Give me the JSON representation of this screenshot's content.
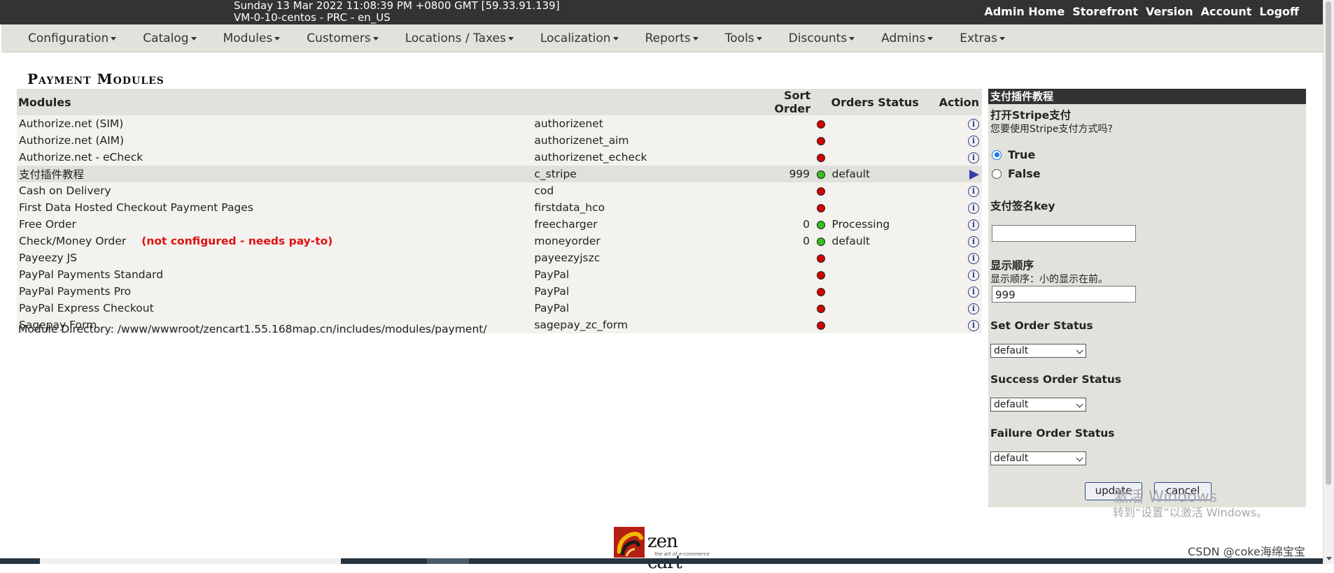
{
  "header": {
    "server_line1": "Sunday 13 Mar 2022 11:08:39 PM +0800 GMT [59.33.91.139]",
    "server_line2": "VM-0-10-centos - PRC - en_US",
    "links": [
      "Admin Home",
      "Storefront",
      "Version",
      "Account",
      "Logoff"
    ]
  },
  "nav": {
    "items": [
      "Configuration",
      "Catalog",
      "Modules",
      "Customers",
      "Locations / Taxes",
      "Localization",
      "Reports",
      "Tools",
      "Discounts",
      "Admins",
      "Extras"
    ]
  },
  "page_title": "Payment Modules",
  "table": {
    "headers": {
      "modules": "Modules",
      "sort_order": "Sort Order",
      "orders_status": "Orders Status",
      "action": "Action"
    },
    "rows": [
      {
        "name": "Authorize.net (SIM)",
        "code": "authorizenet",
        "sort": "",
        "status": "red",
        "order_status": "",
        "action": "info-icon"
      },
      {
        "name": "Authorize.net (AIM)",
        "code": "authorizenet_aim",
        "sort": "",
        "status": "red",
        "order_status": "",
        "action": "info-icon"
      },
      {
        "name": "Authorize.net - eCheck",
        "code": "authorizenet_echeck",
        "sort": "",
        "status": "red",
        "order_status": "",
        "action": "info-icon"
      },
      {
        "name": "支付插件教程",
        "code": "c_stripe",
        "sort": "999",
        "status": "green",
        "order_status": "default",
        "action": "play-icon"
      },
      {
        "name": "Cash on Delivery",
        "code": "cod",
        "sort": "",
        "status": "red",
        "order_status": "",
        "action": "info-icon"
      },
      {
        "name": "First Data Hosted Checkout Payment Pages",
        "code": "firstdata_hco",
        "sort": "",
        "status": "red",
        "order_status": "",
        "action": "info-icon"
      },
      {
        "name": "Free Order",
        "code": "freecharger",
        "sort": "0",
        "status": "green",
        "order_status": "Processing",
        "action": "info-icon"
      },
      {
        "name": "Check/Money Order",
        "warning": "(not configured - needs pay-to)",
        "code": "moneyorder",
        "sort": "0",
        "status": "green",
        "order_status": "default",
        "action": "info-icon"
      },
      {
        "name": "Payeezy JS",
        "code": "payeezyjszc",
        "sort": "",
        "status": "red",
        "order_status": "",
        "action": "info-icon"
      },
      {
        "name": "PayPal Payments Standard",
        "code": "PayPal",
        "sort": "",
        "status": "red",
        "order_status": "",
        "action": "info-icon"
      },
      {
        "name": "PayPal Payments Pro",
        "code": "PayPal",
        "sort": "",
        "status": "red",
        "order_status": "",
        "action": "info-icon"
      },
      {
        "name": "PayPal Express Checkout",
        "code": "PayPal",
        "sort": "",
        "status": "red",
        "order_status": "",
        "action": "info-icon"
      },
      {
        "name": "Sagepay Form",
        "code": "sagepay_zc_form",
        "sort": "",
        "status": "red",
        "order_status": "",
        "action": "info-icon"
      }
    ],
    "colors": {
      "status_red": "#d40000",
      "status_green": "#35c21d"
    }
  },
  "module_directory": "Module Directory: /www/wwwroot/zencart1.55.168map.cn/includes/modules/payment/",
  "panel": {
    "title": "支付插件教程",
    "enable_label": "打开Stripe支付",
    "enable_desc": "您要使用Stripe支付方式吗?",
    "option_true": "True",
    "option_false": "False",
    "selected_option": "True",
    "key_label": "支付签名key",
    "key_value": "",
    "sort_label": "显示顺序",
    "sort_desc": "显示顺序：小的显示在前。",
    "sort_value": "999",
    "set_order_status_label": "Set Order Status",
    "set_order_status_value": "default",
    "success_order_status_label": "Success Order Status",
    "success_order_status_value": "default",
    "failure_order_status_label": "Failure Order Status",
    "failure_order_status_value": "default",
    "update_button": "update",
    "cancel_button": "cancel"
  },
  "watermark": {
    "line1": "激活 Windows",
    "line2": "转到“设置”以激活 Windows。"
  },
  "footer": {
    "logo_text": "zen cart",
    "logo_tagline": "the art of e-commerce"
  },
  "csdn_credit": "CSDN @coke海绵宝宝"
}
